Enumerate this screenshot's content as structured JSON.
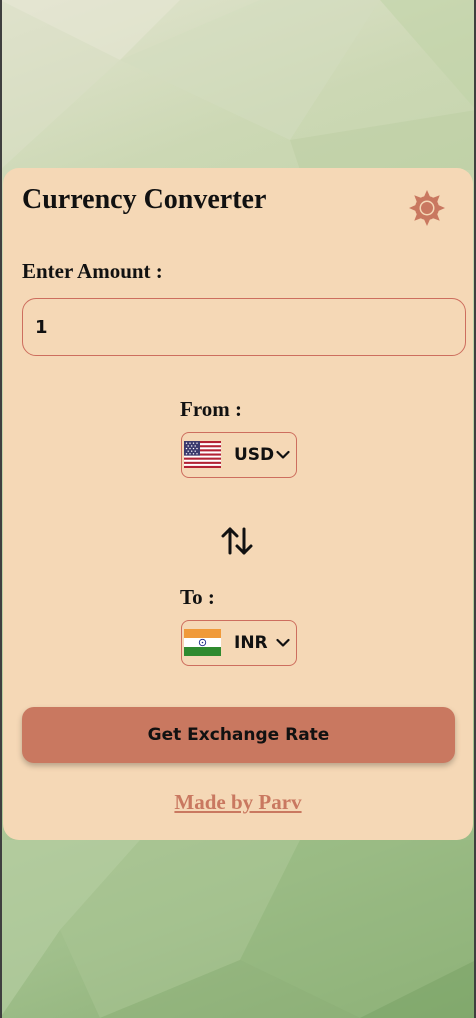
{
  "header": {
    "title": "Currency Converter",
    "theme_icon": "sun-gear-icon"
  },
  "amount": {
    "label": "Enter Amount :",
    "value": "1"
  },
  "from": {
    "label": "From :",
    "currency": "USD",
    "flag_icon": "us-flag-icon"
  },
  "swap": {
    "icon": "swap-arrows-icon"
  },
  "to": {
    "label": "To :",
    "currency": "INR",
    "flag_icon": "india-flag-icon"
  },
  "actions": {
    "primary_label": "Get Exchange Rate"
  },
  "footer": {
    "credit": "Made by Parv"
  },
  "colors": {
    "card": "#f5d8b6",
    "accent": "#c97860",
    "border": "#cd6e5e",
    "background": "#b5cc9e"
  }
}
